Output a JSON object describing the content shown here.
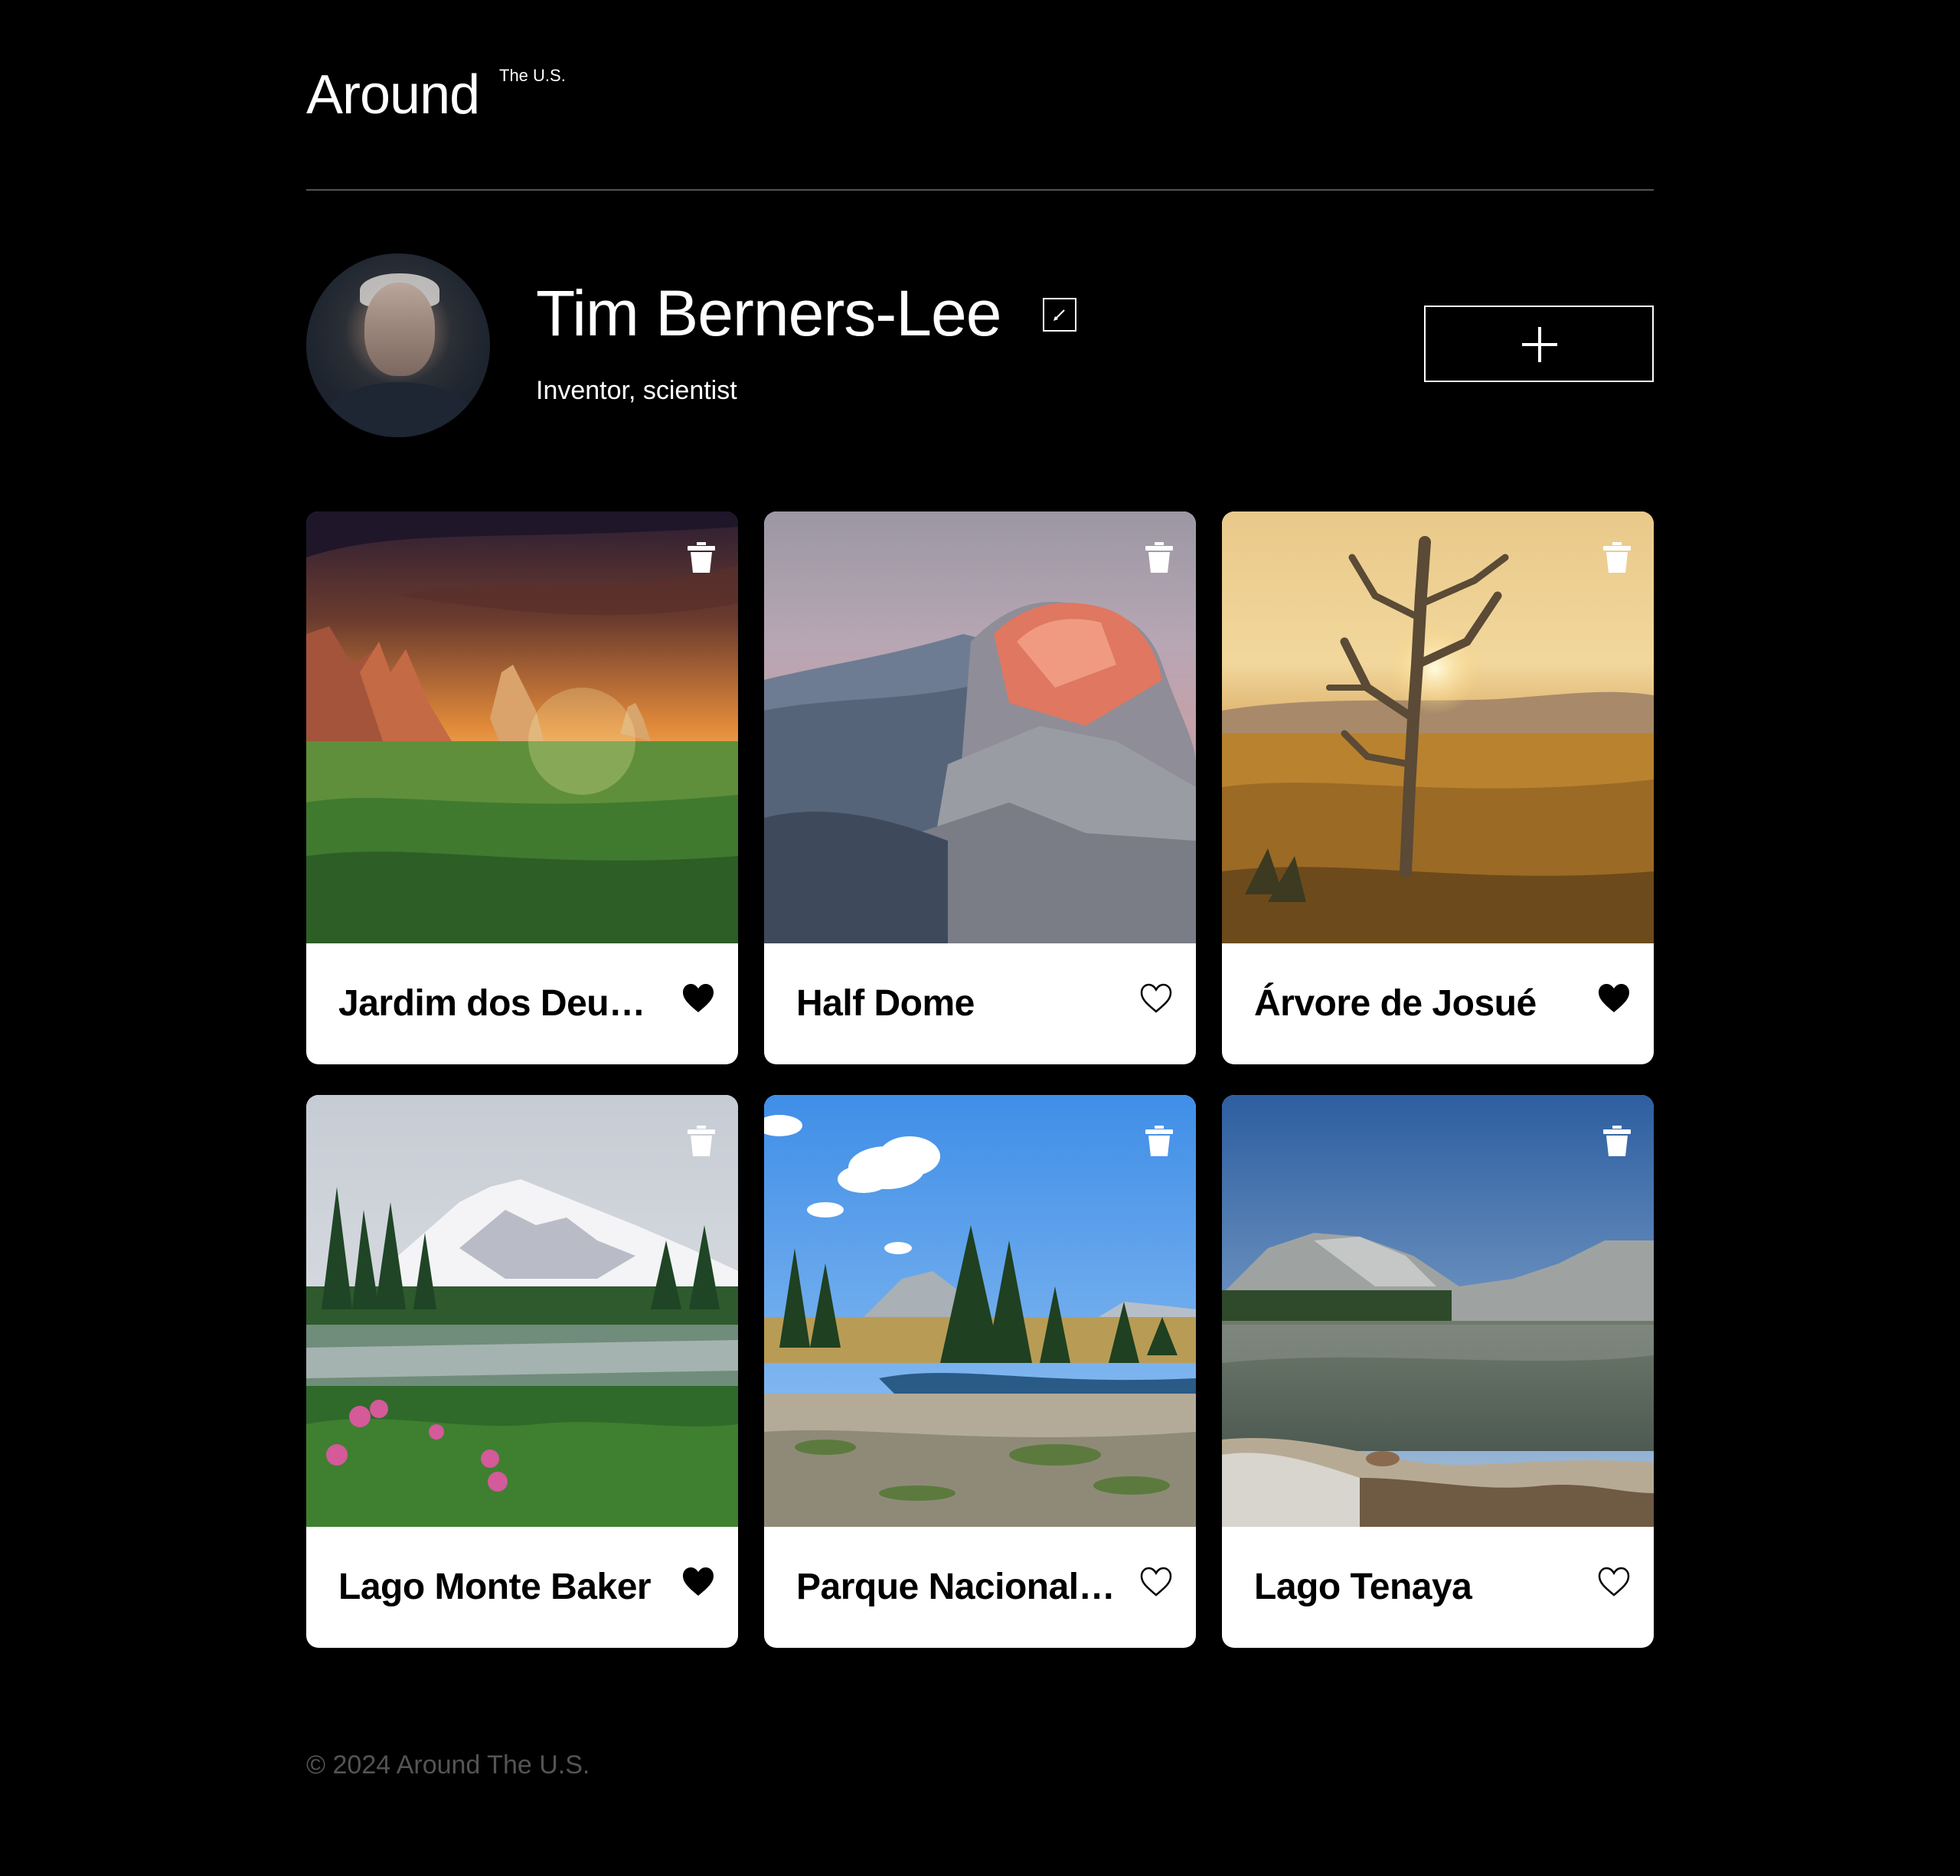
{
  "header": {
    "logo": "Around",
    "logo_sup": "The U.S."
  },
  "profile": {
    "name": "Tim Berners-Lee",
    "about": "Inventor, scientist",
    "avatar_icon": "avatar-photo"
  },
  "icons": {
    "edit": "pencil-icon",
    "add": "plus-icon",
    "delete": "trash-icon",
    "like": "heart-icon"
  },
  "cards": [
    {
      "title": "Jardim dos Deuses",
      "liked": true
    },
    {
      "title": "Half Dome",
      "liked": false
    },
    {
      "title": "Árvore de Josué",
      "liked": true
    },
    {
      "title": "Lago Monte Baker",
      "liked": true
    },
    {
      "title": "Parque Nacional de Yosemite",
      "liked": false
    },
    {
      "title": "Lago Tenaya",
      "liked": false
    }
  ],
  "footer": {
    "copyright": "© 2024 Around The U.S."
  },
  "colors": {
    "background": "#000000",
    "card": "#ffffff",
    "footer_text": "#545454",
    "divider": "#545454"
  }
}
